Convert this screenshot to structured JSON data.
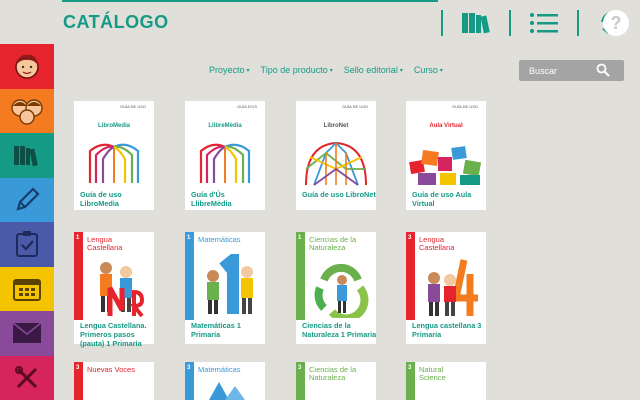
{
  "header": {
    "title": "CATÁLOGO",
    "icons": [
      "library-books-icon",
      "list-menu-icon",
      "sync-icon",
      "help-icon"
    ],
    "help_label": "?"
  },
  "sidebar": {
    "items": [
      {
        "name": "student-face-icon",
        "color": "#e5242d"
      },
      {
        "name": "group-faces-icon",
        "color": "#f47b20"
      },
      {
        "name": "books-icon",
        "color": "#159a86"
      },
      {
        "name": "pencil-icon",
        "color": "#3a9ad9"
      },
      {
        "name": "clipboard-check-icon",
        "color": "#4a5aa8"
      },
      {
        "name": "calendar-icon",
        "color": "#f5c400"
      },
      {
        "name": "envelope-icon",
        "color": "#8a4a9a"
      },
      {
        "name": "tools-icon",
        "color": "#d6245e"
      }
    ]
  },
  "filters": {
    "items": [
      "Proyecto",
      "Tipo de producto",
      "Sello editorial",
      "Curso"
    ],
    "caret": "▾"
  },
  "search": {
    "placeholder": "Buscar"
  },
  "colors": {
    "accent": "#159a86",
    "background": "#e0dfda"
  },
  "books": [
    {
      "caption": "Guía de uso LibroMedia",
      "brand": "LibroMedia",
      "cover_label": "GUÍA DE USO"
    },
    {
      "caption": "Guía d'Ús LlibreMèdia",
      "brand": "LlibreMèdia",
      "cover_label": "GUIA D'ÚS"
    },
    {
      "caption": "Guía de uso LibroNet",
      "brand": "LibroNet",
      "cover_label": "GUÍA DE USO"
    },
    {
      "caption": "Guía de uso Aula Virtual",
      "brand": "Aula Virtual",
      "cover_label": "GUÍA DE USO"
    },
    {
      "caption": "Lengua Castellana. Primeros pasos (pauta) 1 Primaria",
      "num": "1",
      "subject": "Lengua Castellana",
      "color": "#e5242d"
    },
    {
      "caption": "Matemáticas 1 Primaria",
      "num": "1",
      "subject": "Matemáticas",
      "color": "#3a9ad9"
    },
    {
      "caption": "Ciencias de la Naturaleza 1 Primaria",
      "num": "1",
      "subject": "Ciencias de la Naturaleza",
      "color": "#6ab04c"
    },
    {
      "caption": "Lengua castellana 3 Primaria",
      "num": "3",
      "subject": "Lengua Castellana",
      "color": "#e5242d"
    },
    {
      "num": "3",
      "subject": "Nuevas Voces",
      "color": "#e5242d"
    },
    {
      "num": "3",
      "subject": "Matemáticas",
      "color": "#3a9ad9"
    },
    {
      "num": "3",
      "subject": "Ciencias de la Naturaleza",
      "color": "#6ab04c"
    },
    {
      "num": "3",
      "subject": "Natural Science",
      "color": "#6ab04c"
    }
  ]
}
